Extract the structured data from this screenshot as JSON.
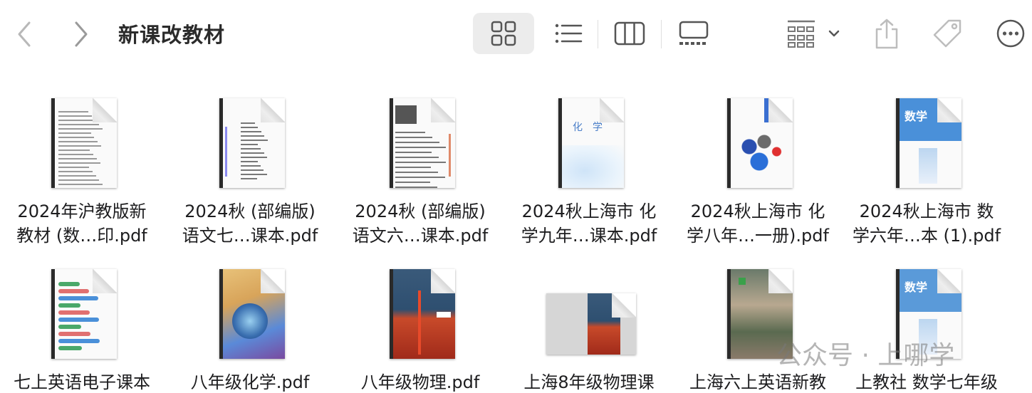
{
  "toolbar": {
    "title": "新课改教材",
    "back_label": "‹",
    "forward_label": "›"
  },
  "files": [
    {
      "line1": "2024年沪教版新",
      "line2": "教材 (数…印.pdf",
      "cover": "text"
    },
    {
      "line1": "2024秋 (部编版)",
      "line2": "语文七…课本.pdf",
      "cover": "toc"
    },
    {
      "line1": "2024秋 (部编版)",
      "line2": "语文六…课本.pdf",
      "cover": "toc2"
    },
    {
      "line1": "2024秋上海市 化",
      "line2": "学九年…课本.pdf",
      "cover": "chem9"
    },
    {
      "line1": "2024秋上海市 化",
      "line2": "学八年…一册).pdf",
      "cover": "chem8"
    },
    {
      "line1": "2024秋上海市 数",
      "line2": "学六年…本 (1).pdf",
      "cover": "math6"
    },
    {
      "line1": "七上英语电子课本",
      "line2": "",
      "cover": "eng7"
    },
    {
      "line1": "八年级化学.pdf",
      "line2": "",
      "cover": "chem8b"
    },
    {
      "line1": "八年级物理.pdf",
      "line2": "",
      "cover": "phys8"
    },
    {
      "line1": "上海8年级物理课",
      "line2": "",
      "cover": "phys8wide"
    },
    {
      "line1": "上海六上英语新教",
      "line2": "",
      "cover": "eng6"
    },
    {
      "line1": "上教社 数学七年级",
      "line2": "",
      "cover": "math7"
    }
  ],
  "watermark": "公众号 · 上哪学",
  "icons": [
    "chevron-left-icon",
    "chevron-right-icon",
    "grid-view-icon",
    "list-view-icon",
    "column-view-icon",
    "gallery-view-icon",
    "group-icon",
    "share-icon",
    "tag-icon",
    "more-icon"
  ]
}
